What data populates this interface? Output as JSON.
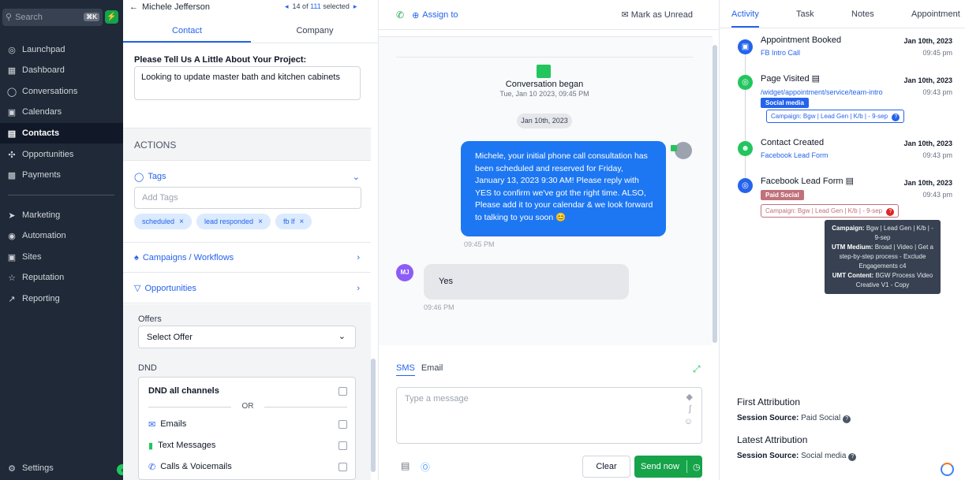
{
  "sidebar": {
    "search_placeholder": "Search",
    "search_shortcut": "⌘K",
    "items": [
      {
        "label": "Launchpad",
        "icon": "launchpad-icon"
      },
      {
        "label": "Dashboard",
        "icon": "dashboard-icon"
      },
      {
        "label": "Conversations",
        "icon": "chat-icon"
      },
      {
        "label": "Calendars",
        "icon": "calendar-icon"
      },
      {
        "label": "Contacts",
        "icon": "contacts-icon",
        "active": true
      },
      {
        "label": "Opportunities",
        "icon": "opportunities-icon"
      },
      {
        "label": "Payments",
        "icon": "payments-icon"
      },
      {
        "label": "Marketing",
        "icon": "send-icon"
      },
      {
        "label": "Automation",
        "icon": "automation-icon"
      },
      {
        "label": "Sites",
        "icon": "sites-icon"
      },
      {
        "label": "Reputation",
        "icon": "star-icon"
      },
      {
        "label": "Reporting",
        "icon": "reporting-icon"
      }
    ],
    "settings_label": "Settings"
  },
  "contact": {
    "name": "Michele Jefferson",
    "pager_index": "14 of",
    "pager_total": "111",
    "pager_selected": "selected",
    "tabs": [
      "Contact",
      "Company"
    ],
    "question_label": "Please Tell Us A Little About Your Project:",
    "question_value": "Looking to update master bath and kitchen cabinets",
    "actions_label": "ACTIONS",
    "tags_label": "Tags",
    "tags_placeholder": "Add Tags",
    "tags": [
      "scheduled",
      "lead responded",
      "fb lf"
    ],
    "campaigns_label": "Campaigns / Workflows",
    "opportunities_label": "Opportunities",
    "offers_label": "Offers",
    "offer_select": "Select Offer",
    "dnd_label": "DND",
    "dnd_all": "DND all channels",
    "or_label": "OR",
    "dnd_channels": [
      "Emails",
      "Text Messages",
      "Calls & Voicemails"
    ]
  },
  "conversation": {
    "assign_label": "Assign to",
    "mark_unread": "Mark as Unread",
    "began_title": "Conversation began",
    "began_date": "Tue, Jan 10 2023, 09:45 PM",
    "date_pill": "Jan 10th, 2023",
    "outgoing_text": "Michele, your initial phone call consultation has been scheduled and reserved for Friday, January 13, 2023 9:30 AM! Please reply with YES to confirm we've got the right time. ALSO, Please add it to your calendar & we look forward to talking to you soon 😊",
    "outgoing_time": "09:45 PM",
    "incoming_initials": "MJ",
    "incoming_text": "Yes",
    "incoming_time": "09:46 PM",
    "compose_tabs": [
      "SMS",
      "Email"
    ],
    "compose_placeholder": "Type a message",
    "clear_label": "Clear",
    "send_label": "Send now"
  },
  "activity": {
    "tabs": [
      "Activity",
      "Task",
      "Notes",
      "Appointment"
    ],
    "events": [
      {
        "title": "Appointment Booked",
        "sub": "FB Intro Call",
        "date": "Jan 10th, 2023",
        "time": "09:45 pm",
        "icon": "calendar-icon",
        "color": "#2563eb"
      },
      {
        "title": "Page Visited",
        "sub": "/widget/appointment/service/team-intro",
        "date": "Jan 10th, 2023",
        "time": "09:43 pm",
        "icon": "globe-icon",
        "color": "#22c55e",
        "badge": "Social media",
        "campaign": "Campaign: Bgw | Lead Gen | K/b | - 9-sep"
      },
      {
        "title": "Contact Created",
        "sub": "Facebook Lead Form",
        "date": "Jan 10th, 2023",
        "time": "09:43 pm",
        "icon": "user-plus-icon",
        "color": "#22c55e"
      },
      {
        "title": "Facebook Lead Form",
        "sub": "",
        "date": "Jan 10th, 2023",
        "time": "09:43 pm",
        "icon": "globe-icon",
        "color": "#2563eb",
        "badge": "Paid Social",
        "campaign": "Campaign: Bgw | Lead Gen | K/b | - 9-sep"
      }
    ],
    "tooltip": {
      "campaign_label": "Campaign:",
      "campaign_value": "Bgw | Lead Gen | K/b | - 9-sep",
      "utm_label": "UTM Medium:",
      "utm_value": "Broad | Video | Get a step-by-step process - Exclude Engagements c4",
      "content_label": "UMT Content:",
      "content_value": "BGW Process Video Creative V1 - Copy"
    },
    "first_attribution": "First Attribution",
    "first_source_label": "Session Source:",
    "first_source": "Paid Social",
    "latest_attribution": "Latest Attribution",
    "latest_source_label": "Session Source:",
    "latest_source": "Social media"
  },
  "colors": {
    "sidebar_bg": "#1f2937",
    "accent": "#2563eb",
    "send_green": "#16a34a",
    "bubble_blue": "#1d77f2",
    "social_badge": "#2563eb",
    "paid_badge": "#c0717a"
  }
}
